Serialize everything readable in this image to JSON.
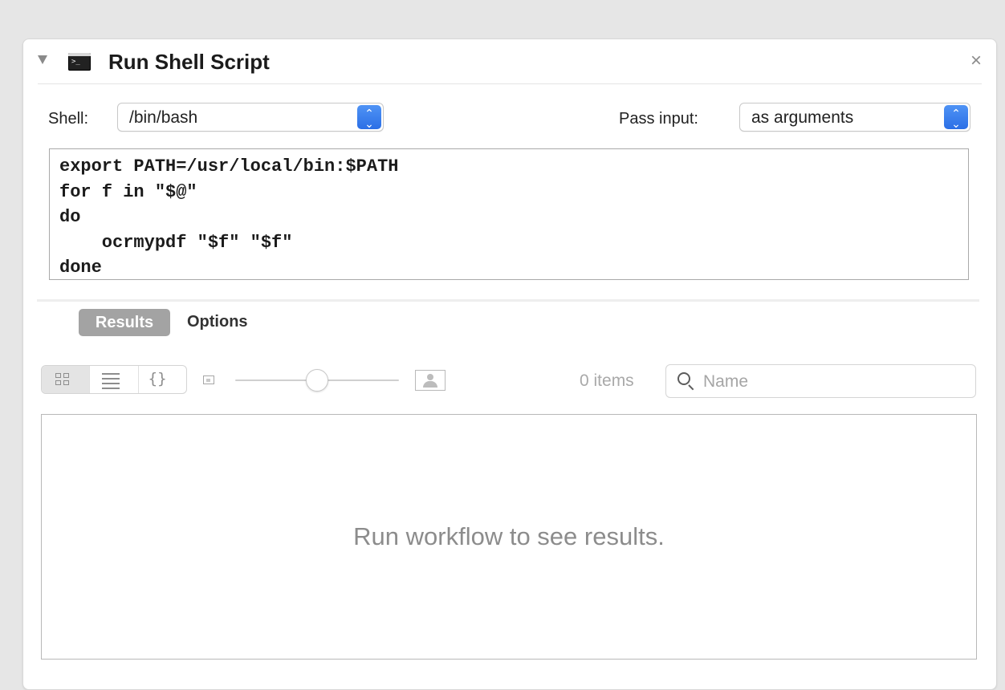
{
  "action": {
    "title": "Run Shell Script",
    "icons": {
      "disclosure": "disclosure-triangle-down",
      "app": "terminal-icon",
      "close": "close-x"
    },
    "close_glyph": "×",
    "terminal_prompt": ">_"
  },
  "shell": {
    "label": "Shell:",
    "value": "/bin/bash"
  },
  "pass_input": {
    "label": "Pass input:",
    "value": "as arguments"
  },
  "stepper_glyphs": {
    "up": "⌃",
    "down": "⌄"
  },
  "script": {
    "code": "export PATH=/usr/local/bin:$PATH\nfor f in \"$@\"\ndo\n    ocrmypdf \"$f\" \"$f\"\ndone"
  },
  "tabs": {
    "results": "Results",
    "options": "Options",
    "selected": "Results"
  },
  "toolbar": {
    "view_modes": [
      "icon-view",
      "list-view",
      "code-view"
    ],
    "code_view_glyph": "{}",
    "zoom_level": 0.5,
    "items_count": "0 items",
    "search_placeholder": "Name"
  },
  "results": {
    "empty_message": "Run workflow to see results."
  },
  "colors": {
    "accent": "#2b6fe6",
    "tab_selected": "#a3a3a3"
  }
}
